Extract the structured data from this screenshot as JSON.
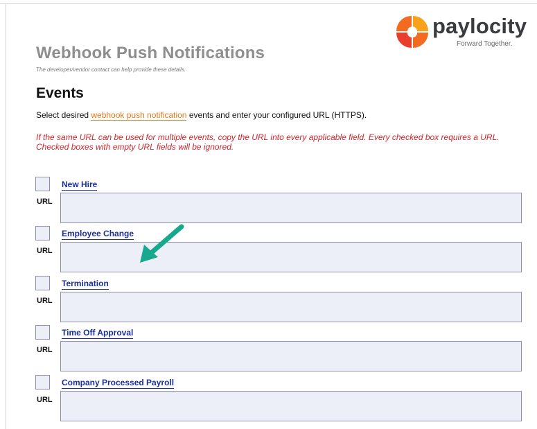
{
  "logo": {
    "wordmark": "paylocity",
    "tagline": "Forward Together.",
    "brand_colors": [
      "#f26b21",
      "#ea3e2d",
      "#f8a21b",
      "#3a3b3f"
    ]
  },
  "header": {
    "title": "Webhook Push Notifications",
    "subtitle": "The developer/vendor contact can help provide these details."
  },
  "events_section": {
    "heading": "Events",
    "intro_prefix": "Select desired ",
    "intro_link": "webhook push notification",
    "intro_suffix": " events and enter your configured URL (HTTPS).",
    "warning": "If the same URL can be used for multiple events, copy the URL into every applicable field. Every checked box requires a URL. Checked boxes with empty URL fields will be ignored."
  },
  "events": [
    {
      "label": "New Hire",
      "url_label": "URL",
      "url_value": "",
      "checked": false
    },
    {
      "label": "Employee Change",
      "url_label": "URL",
      "url_value": "",
      "checked": false
    },
    {
      "label": "Termination",
      "url_label": "URL",
      "url_value": "",
      "checked": false
    },
    {
      "label": "Time Off Approval",
      "url_label": "URL",
      "url_value": "",
      "checked": false
    },
    {
      "label": "Company Processed Payroll",
      "url_label": "URL",
      "url_value": "",
      "checked": false
    }
  ],
  "annotation": {
    "icon": "arrow-icon",
    "color": "#17a98e"
  }
}
